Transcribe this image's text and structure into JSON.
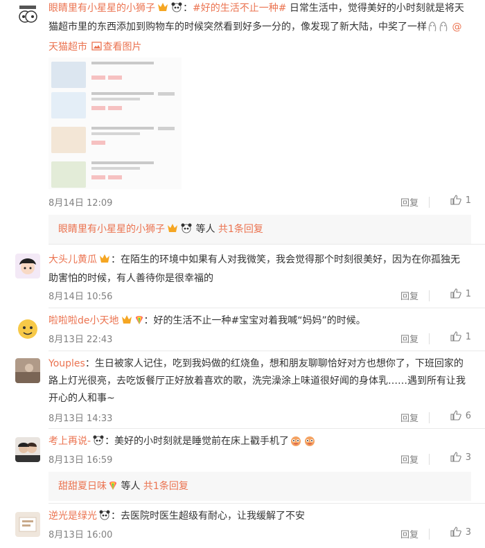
{
  "comments": [
    {
      "user": "眼睛里有小星星的小狮子",
      "segments": [
        {
          "t": "：",
          "c": "text"
        },
        {
          "t": "#好的生活不止一种#",
          "c": "link"
        },
        {
          "t": " 日常生活中，觉得美好的小时刻就是将天猫超市里的东西添加到购物车的时候突然看到好多一分的，像发现了新大陆，中奖了一样",
          "c": "text"
        },
        {
          "t": " @天猫超市",
          "c": "link"
        },
        {
          "t": "  ",
          "c": "text"
        },
        {
          "t": "查看图片",
          "c": "link"
        }
      ],
      "time": "8月14日 12:09",
      "reply_label": "回复",
      "likes": "1",
      "sub_reply": {
        "user": "眼睛里有小星星的小狮子",
        "and_others": " 等人 ",
        "count_text": "共1条回复"
      }
    },
    {
      "user": "大头儿黄瓜",
      "segments": [
        {
          "t": "：在陌生的环境中如果有人对我微笑，我会觉得那个时刻很美好，因为在你孤独无助害怕的时候，有人善待你是很幸福的",
          "c": "text"
        }
      ],
      "time": "8月14日 10:56",
      "reply_label": "回复",
      "likes": "1"
    },
    {
      "user": "啦啦啦de小天地",
      "segments": [
        {
          "t": "：好的生活不止一种#宝宝对着我喊“妈妈”的时候。",
          "c": "text"
        }
      ],
      "time": "8月13日 22:43",
      "reply_label": "回复",
      "likes": "1"
    },
    {
      "user": "Youples",
      "segments": [
        {
          "t": "：生日被家人记住，吃到我妈做的红烧鱼，想和朋友聊聊恰好对方也想你了，下班回家的路上灯光很亮，去吃饭餐厅正好放着喜欢的歌，洗完澡涂上味道很好闻的身体乳……遇到所有让我开心的人和事~",
          "c": "text"
        }
      ],
      "time": "8月13日 14:33",
      "reply_label": "回复",
      "likes": "6"
    },
    {
      "user": "考上再说-",
      "segments": [
        {
          "t": "：美好的小时刻就是睡觉前在床上戳手机了",
          "c": "text"
        }
      ],
      "time": "8月13日 16:59",
      "reply_label": "回复",
      "likes": "3",
      "sub_reply": {
        "user": "甜甜夏日味",
        "and_others": " 等人 ",
        "count_text": "共1条回复"
      }
    },
    {
      "user": "逆光是绿光",
      "segments": [
        {
          "t": "：去医院时医生超级有耐心，让我缓解了不安",
          "c": "text"
        }
      ],
      "time": "8月13日 16:00",
      "reply_label": "回复",
      "likes": "3"
    }
  ],
  "colors": {
    "link": "#eb7350",
    "meta": "#808080",
    "subreply_bg": "#f7f7f7"
  },
  "icons": [
    "avatar",
    "vip-badge-icon",
    "panda-icon",
    "image-icon",
    "thumb-up-icon",
    "rainbow-badge-icon",
    "laugh-emoji-icon"
  ]
}
